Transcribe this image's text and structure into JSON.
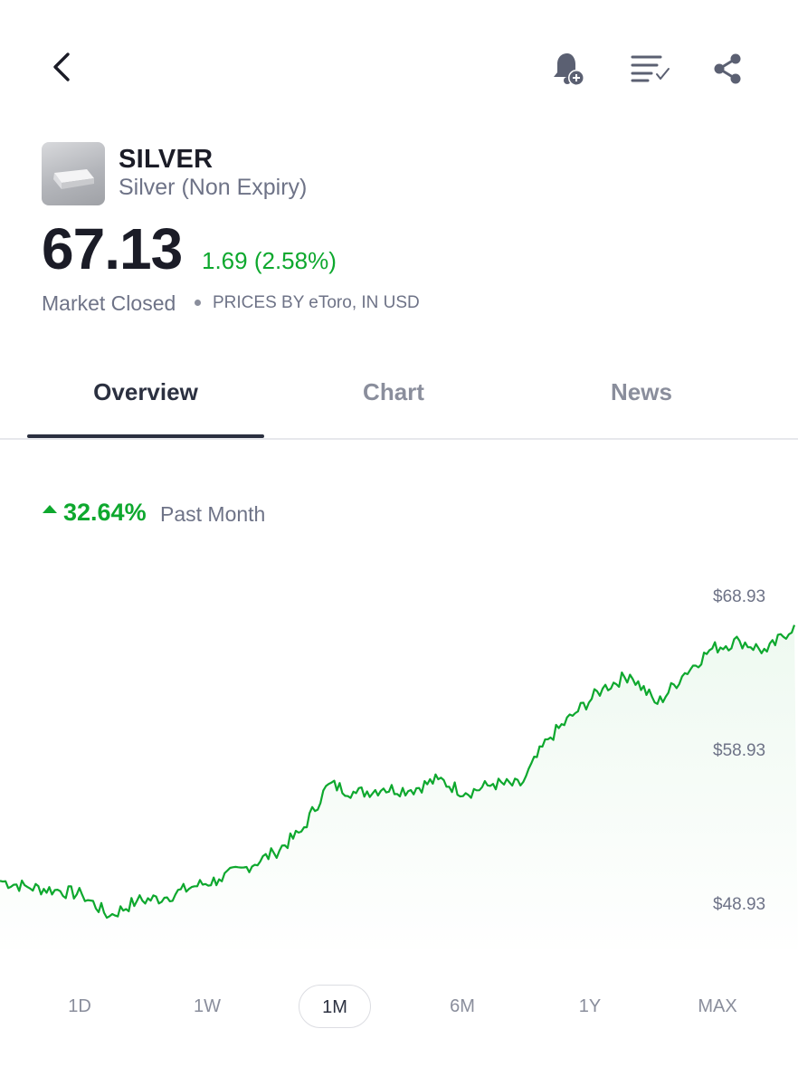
{
  "header": {
    "back_icon": "chevron-left-icon",
    "actions": [
      {
        "name": "add-alert",
        "icon": "bell-plus-icon"
      },
      {
        "name": "watchlist",
        "icon": "list-check-icon"
      },
      {
        "name": "share",
        "icon": "share-icon"
      }
    ]
  },
  "instrument": {
    "logo_icon": "silver-bar-icon",
    "symbol": "SILVER",
    "full_name": "Silver (Non Expiry)",
    "price": "67.13",
    "change": "1.69 (2.58%)",
    "market_status": "Market Closed",
    "prices_by": "PRICES BY eToro, IN USD"
  },
  "tabs": [
    {
      "label": "Overview",
      "active": true
    },
    {
      "label": "Chart",
      "active": false
    },
    {
      "label": "News",
      "active": false
    }
  ],
  "performance": {
    "value": "32.64%",
    "period": "Past Month",
    "direction": "up"
  },
  "chart_data": {
    "type": "line",
    "y_tick_labels": [
      "$68.93",
      "$58.93",
      "$48.93"
    ],
    "y_ticks": [
      68.93,
      58.93,
      48.93
    ],
    "ylim": [
      44.5,
      71.5
    ],
    "x_count": 30,
    "values": [
      50.5,
      50.1,
      49.9,
      49.6,
      48.2,
      49.2,
      49.4,
      50.1,
      50.6,
      51.4,
      52.3,
      53.7,
      56.8,
      56.2,
      56.5,
      56.4,
      57.1,
      56.2,
      56.8,
      56.7,
      59.7,
      61.4,
      63.0,
      63.9,
      62.0,
      64.0,
      65.6,
      66.1,
      65.4,
      67.13
    ],
    "line_color": "#0ea82e",
    "grid": false
  },
  "range_selector": {
    "options": [
      "1D",
      "1W",
      "1M",
      "6M",
      "1Y",
      "MAX"
    ],
    "selected": "1M"
  },
  "colors": {
    "accent_green": "#0ea82e",
    "text_primary": "#1b1c27",
    "text_secondary": "#6e7387"
  }
}
